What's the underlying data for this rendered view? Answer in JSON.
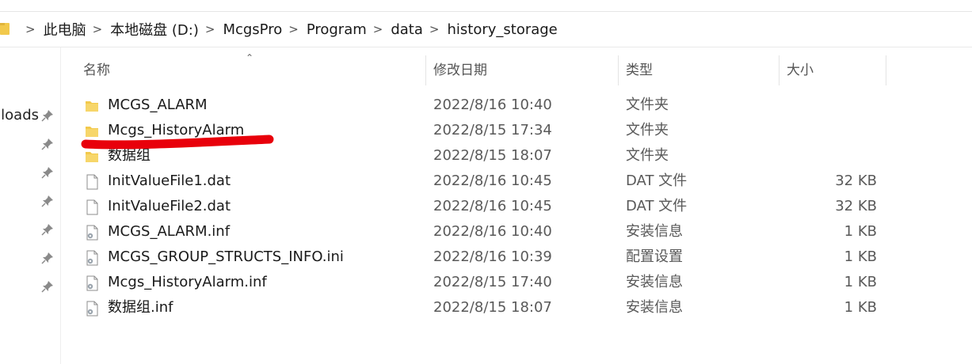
{
  "breadcrumb": [
    "此电脑",
    "本地磁盘 (D:)",
    "McgsPro",
    "Program",
    "data",
    "history_storage"
  ],
  "nav": {
    "quick_access_label": "Downloads"
  },
  "columns": {
    "name": "名称",
    "date": "修改日期",
    "type": "类型",
    "size": "大小"
  },
  "files": [
    {
      "name": "MCGS_ALARM",
      "date": "2022/8/16 10:40",
      "type": "文件夹",
      "size": "",
      "icon": "folder-icon"
    },
    {
      "name": "Mcgs_HistoryAlarm",
      "date": "2022/8/15 17:34",
      "type": "文件夹",
      "size": "",
      "icon": "folder-icon"
    },
    {
      "name": "数据组",
      "date": "2022/8/15 18:07",
      "type": "文件夹",
      "size": "",
      "icon": "folder-icon"
    },
    {
      "name": "InitValueFile1.dat",
      "date": "2022/8/16 10:45",
      "type": "DAT 文件",
      "size": "32 KB",
      "icon": "file-icon"
    },
    {
      "name": "InitValueFile2.dat",
      "date": "2022/8/16 10:45",
      "type": "DAT 文件",
      "size": "32 KB",
      "icon": "file-icon"
    },
    {
      "name": "MCGS_ALARM.inf",
      "date": "2022/8/16 10:40",
      "type": "安装信息",
      "size": "1 KB",
      "icon": "settings-file-icon"
    },
    {
      "name": "MCGS_GROUP_STRUCTS_INFO.ini",
      "date": "2022/8/16 10:39",
      "type": "配置设置",
      "size": "1 KB",
      "icon": "settings-file-icon"
    },
    {
      "name": "Mcgs_HistoryAlarm.inf",
      "date": "2022/8/15 17:40",
      "type": "安装信息",
      "size": "1 KB",
      "icon": "settings-file-icon"
    },
    {
      "name": "数据组.inf",
      "date": "2022/8/15 18:07",
      "type": "安装信息",
      "size": "1 KB",
      "icon": "settings-file-icon"
    }
  ],
  "colors": {
    "folder": "#f2c94c",
    "annotation": "#e8000b"
  }
}
